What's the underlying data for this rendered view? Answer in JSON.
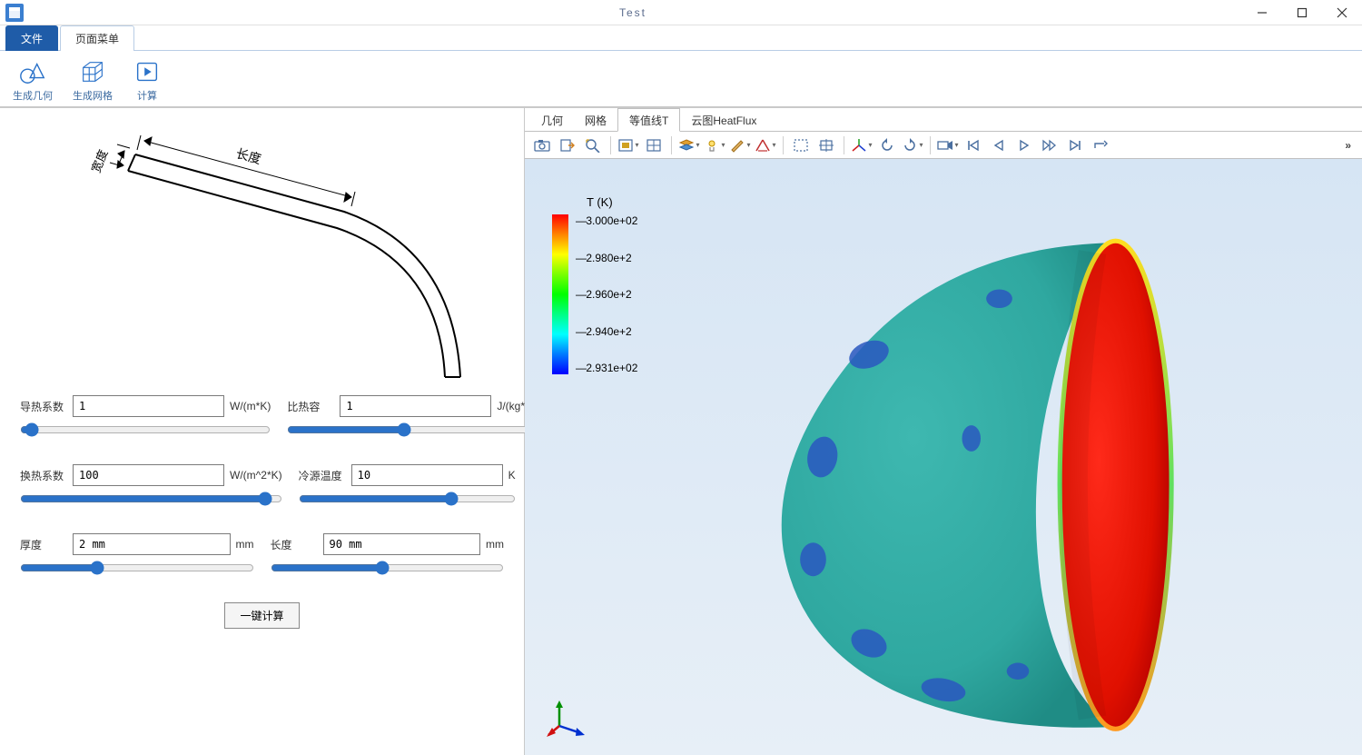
{
  "window": {
    "title": "Test"
  },
  "menu_tabs": {
    "file": "文件",
    "page": "页面菜单"
  },
  "ribbon": {
    "geometry": "生成几何",
    "mesh": "生成网格",
    "compute": "计算"
  },
  "view_tabs": {
    "geometry": "几何",
    "mesh": "网格",
    "isoline": "等值线T",
    "cloud": "云图HeatFlux"
  },
  "diagram": {
    "length_label": "长度",
    "width_label": "宽度"
  },
  "form": {
    "thermal_cond": {
      "label": "导热系数",
      "value": "1",
      "unit": "W/(m*K)"
    },
    "specific_heat": {
      "label": "比热容",
      "value": "1",
      "unit": "J/(kg*K)"
    },
    "heat_transfer": {
      "label": "换热系数",
      "value": "100",
      "unit": "W/(m^2*K)"
    },
    "cold_temp": {
      "label": "冷源温度",
      "value": "10",
      "unit": "K"
    },
    "thickness": {
      "label": "厚度",
      "value": "2 mm",
      "unit": "mm"
    },
    "length": {
      "label": "长度",
      "value": "90 mm",
      "unit": "mm"
    },
    "compute_button": "一键计算"
  },
  "legend": {
    "title": "T (K)",
    "ticks": [
      "3.000e+02",
      "2.980e+2",
      "2.960e+2",
      "2.940e+2",
      "2.931e+02"
    ]
  },
  "toolbar3d": {
    "camera": "camera-icon",
    "export": "export-icon",
    "zoom": "zoom-reset-icon",
    "layout1": "frame-select-icon",
    "layout2": "frame-fit-icon",
    "layers": "layers-icon",
    "light": "light-icon",
    "brush": "brush-icon",
    "ruler": "ruler-icon",
    "select_rect": "select-rect-icon",
    "select_move": "select-move-icon",
    "axes": "axes-icon",
    "rotate_ccw": "rotate-ccw-icon",
    "rotate_cw": "rotate-cw-icon",
    "video": "video-icon",
    "first": "first-frame-icon",
    "prev": "prev-frame-icon",
    "play": "play-icon",
    "next": "next-frame-icon",
    "last": "last-frame-icon",
    "loop": "loop-icon"
  }
}
